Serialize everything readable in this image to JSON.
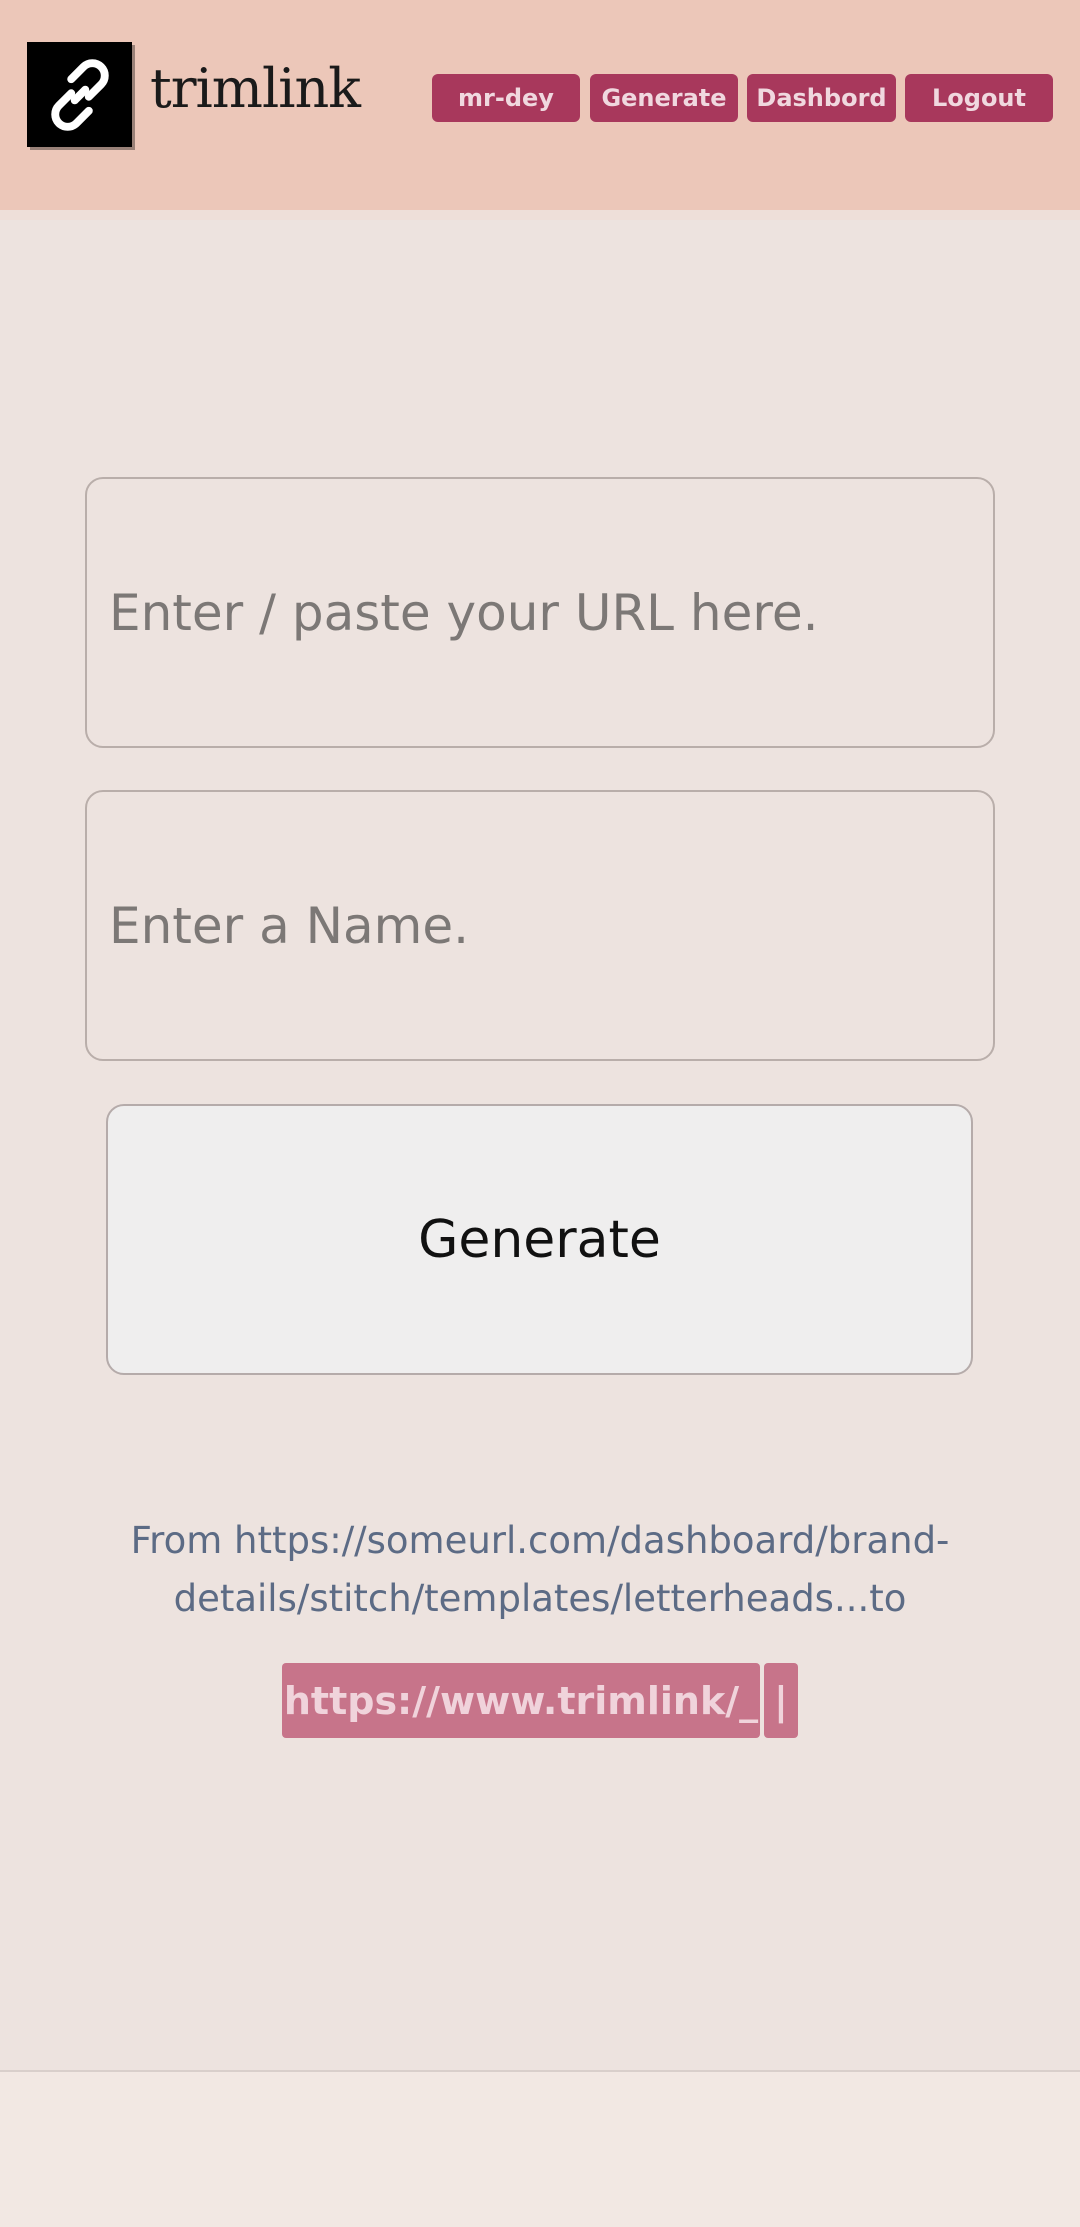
{
  "header": {
    "brand": "trimlink",
    "logo_icon": "link-icon",
    "nav": {
      "user_label": "mr-dey",
      "generate_label": "Generate",
      "dashboard_label": "Dashbord",
      "logout_label": "Logout"
    },
    "accent_color": "#a8385c"
  },
  "form": {
    "url_placeholder": "Enter / paste your URL here.",
    "url_value": "",
    "name_placeholder": "Enter a Name.",
    "name_value": "",
    "generate_label": "Generate"
  },
  "preview": {
    "from_text": "From https://someurl.com/dashboard/brand-details/stitch/templates/letterheads...to",
    "short_url": "https://www.trimlink/_",
    "cursor": "|"
  }
}
